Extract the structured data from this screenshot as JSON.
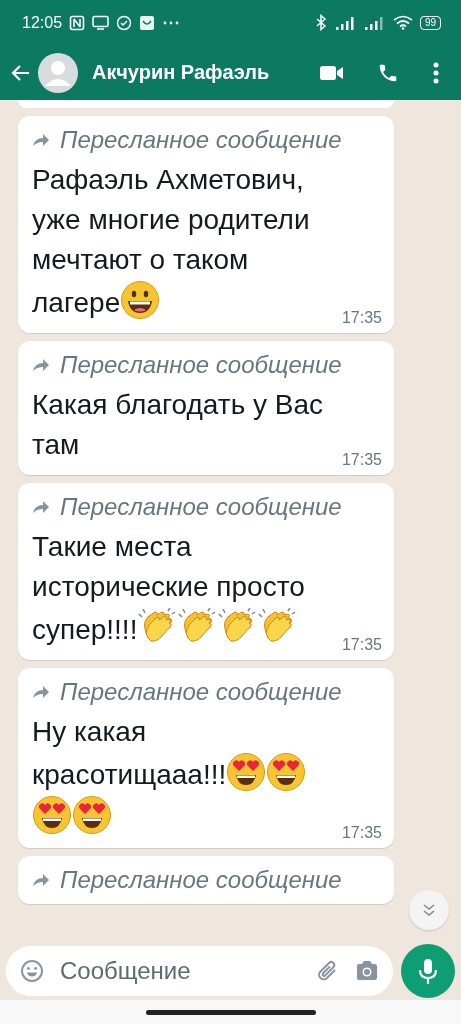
{
  "status_bar": {
    "time": "12:05",
    "battery": "99"
  },
  "header": {
    "contact_name": "Акчурин Рафаэль"
  },
  "messages": [
    {
      "forwarded_label": "Пересланное сообщение",
      "lines": [
        {
          "text": "Рафаэль Ахметович,"
        },
        {
          "text": "уже многие родители"
        },
        {
          "text": "мечтают о таком"
        },
        {
          "text": "лагере",
          "emoji": [
            {
              "kind": "grin"
            }
          ]
        }
      ],
      "time": "17:35"
    },
    {
      "forwarded_label": "Пересланное сообщение",
      "lines": [
        {
          "text": "Какая благодать у Вас"
        },
        {
          "text": "там"
        }
      ],
      "time": "17:35"
    },
    {
      "forwarded_label": "Пересланное сообщение",
      "lines": [
        {
          "text": "Такие места"
        },
        {
          "text": "исторические просто"
        },
        {
          "text": "супер!!!!",
          "emoji": [
            {
              "kind": "clap"
            },
            {
              "kind": "clap"
            },
            {
              "kind": "clap"
            },
            {
              "kind": "clap"
            }
          ]
        }
      ],
      "time": "17:35"
    },
    {
      "forwarded_label": "Пересланное сообщение",
      "lines": [
        {
          "text": "Ну какая"
        },
        {
          "text": "красотищааа!!!",
          "emoji": [
            {
              "kind": "heart_eyes"
            },
            {
              "kind": "heart_eyes"
            }
          ]
        },
        {
          "emoji": [
            {
              "kind": "heart_eyes"
            },
            {
              "kind": "heart_eyes"
            }
          ]
        }
      ],
      "time": "17:35"
    },
    {
      "forwarded_label": "Пересланное сообщение"
    }
  ],
  "composer": {
    "placeholder": "Сообщение"
  }
}
